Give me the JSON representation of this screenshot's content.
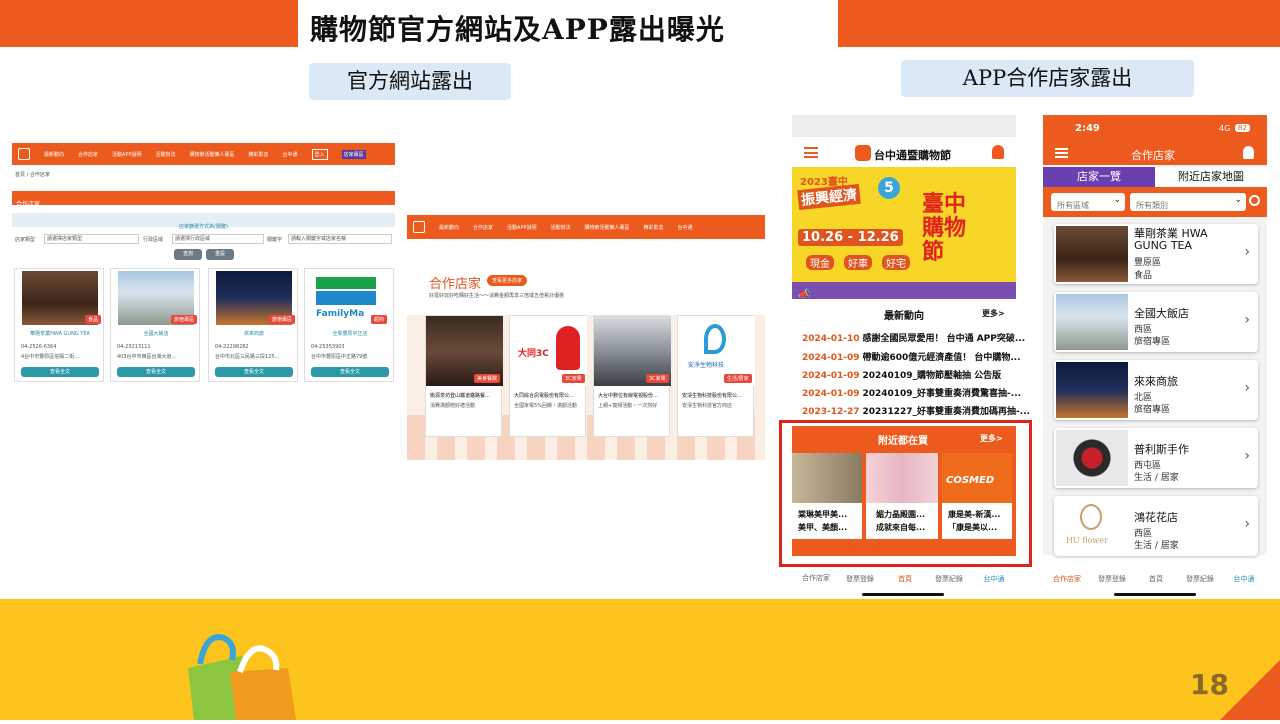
{
  "slide": {
    "title": "購物節官方網站及APP露出曝光",
    "label_web": "官方網站露出",
    "label_app": "APP合作店家露出",
    "page_number": "18"
  },
  "web1": {
    "nav_items": [
      "最新動向",
      "合作店家",
      "活動APP說明",
      "活動辦法",
      "購物節活動懶人專區",
      "精彩影音"
    ],
    "nav_brand": "台中通",
    "nav_btn1": "登入",
    "nav_btn2": "店家專區",
    "breadcrumb": "首頁 / 合作店家",
    "section_title": "合作店家",
    "filter_bar": "店家篩選方式為(關鍵)",
    "filter_labels": [
      "店家類型",
      "行政區域",
      "關鍵字"
    ],
    "filter_select1": "請選擇店家類型",
    "filter_select2": "請選擇行政區域",
    "filter_input": "請輸入關鍵字或店家名稱",
    "btn_search": "查詢",
    "btn_reset": "重設",
    "stores": [
      {
        "name": "華剛茶業HWA GUNG TEA",
        "badge": "食品",
        "phone": "04-2526-6364",
        "addr": "4台中市豐原區信陽二街...",
        "btn": "查看全文"
      },
      {
        "name": "全國大飯店",
        "badge": "旅宿專區",
        "phone": "04-23213111",
        "addr": "403台中市西區台灣大道...",
        "btn": "查看全文"
      },
      {
        "name": "來來商旅",
        "badge": "旅宿專區",
        "phone": "04-22298282",
        "addr": "台中市北區三民路三段125...",
        "btn": "查看全文"
      },
      {
        "name": "全家豐原中正店",
        "badge": "超商",
        "phone": "04-25353903",
        "addr": "台中市豐原區中正路79號",
        "btn": "查看全文"
      }
    ]
  },
  "web2": {
    "nav_items": [
      "最新動向",
      "合作店家",
      "活動APP說明",
      "活動辦法",
      "購物節活動懶人專區",
      "精彩影音"
    ],
    "nav_brand": "台中通",
    "section_title": "合作店家",
    "more_btn": "查看更多店家",
    "subtitle": "好逛好玩好吃購好生活～～消費金額再享三倍或五倍累計優惠",
    "stores": [
      {
        "name": "桃源茶坊登山鐵道鐵路餐...",
        "badge": "美食餐飲",
        "desc": "消費滿額贈好禮活動"
      },
      {
        "name": "大同綜合訊電股份有限公...",
        "badge": "3C家電",
        "desc": "全國家電5%回饋・滿額活動"
      },
      {
        "name": "大台中數位有線電視股份...",
        "badge": "3C家電",
        "desc": "上網+寬頻活動・一次辦好"
      },
      {
        "name": "安淨生物科技股份有限公...",
        "badge": "生活/居家",
        "desc": "安淨生物科技官方商店"
      }
    ]
  },
  "phone1": {
    "status_time": "",
    "app_title": "台中通暨購物節",
    "banner_year": "2023臺中",
    "banner_slogan": "振興經濟",
    "banner_main": "臺中購物節",
    "banner_dates": "10.26 - 12.26",
    "banner_tags": [
      "現金",
      "好車",
      "好宅"
    ],
    "banner_badge": "5",
    "news_title": "最新動向",
    "news_more": "更多>",
    "news": [
      {
        "date": "2024-01-10",
        "text": "感謝全國民眾愛用！ 台中通 APP突破..."
      },
      {
        "date": "2024-01-09",
        "text": "帶動逾600億元經濟產值！ 台中購物..."
      },
      {
        "date": "2024-01-09",
        "text": "20240109_購物節壓軸抽 公告版"
      },
      {
        "date": "2024-01-09",
        "text": "20240109_好事雙重奏消費驚喜抽-..."
      },
      {
        "date": "2023-12-27",
        "text": "20231227_好事雙重奏消費加碼再抽-..."
      }
    ],
    "nearby_title": "附近都在買",
    "nearby_more": "更多>",
    "nearby": [
      {
        "line1": "棠琳美甲美...",
        "line2": "美甲、美顏..."
      },
      {
        "line1": "媚力晶殿園...",
        "line2": "成就來自每..."
      },
      {
        "line1": "康是美-新漢...",
        "line2": "「康是美以..."
      }
    ],
    "cosmed": "COSMED",
    "tabs": [
      "合作店家",
      "發票登錄",
      "首頁",
      "發票紀錄",
      "台中通"
    ]
  },
  "phone2": {
    "status_time": "2:49",
    "status_net": "4G",
    "status_batt": "82",
    "header_title": "合作店家",
    "tab_list": "店家一覽",
    "tab_map": "附近店家地圖",
    "select1": "所有區域",
    "select2": "所有類別",
    "stores": [
      {
        "name": "華剛茶業 HWA GUNG TEA",
        "area": "豐原區",
        "cat": "食品"
      },
      {
        "name": "全國大飯店",
        "area": "西區",
        "cat": "旅宿專區"
      },
      {
        "name": "來來商旅",
        "area": "北區",
        "cat": "旅宿專區"
      },
      {
        "name": "普利斯手作",
        "area": "西屯區",
        "cat": "生活 / 居家"
      },
      {
        "name": "鴻花花店",
        "area": "西區",
        "cat": "生活 / 居家"
      }
    ],
    "hu_flower": "HU flower",
    "tabs": [
      "合作店家",
      "發票登錄",
      "首頁",
      "發票紀錄",
      "台中通"
    ]
  },
  "colors": {
    "accent": "#ec5a1d",
    "footer": "#fcc41c",
    "teal": "#2b9aa8",
    "highlight": "#e0231b"
  }
}
